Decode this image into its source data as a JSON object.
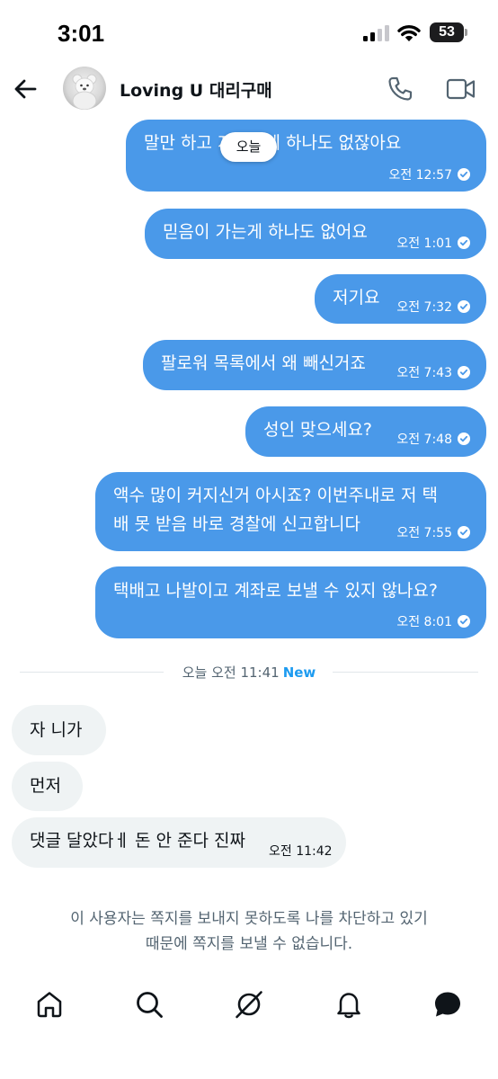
{
  "status_bar": {
    "time": "3:01",
    "battery": "53"
  },
  "header": {
    "title": "Loving U 대리구매",
    "icons": [
      "back-arrow-icon",
      "avatar",
      "phone-icon",
      "video-camera-icon"
    ]
  },
  "today_pill": "오늘",
  "sent_messages": [
    {
      "text": "말만 하고 지키신게 하나도 없잖아요",
      "time": "오전 12:57"
    },
    {
      "text": "믿음이 가는게 하나도 없어요",
      "time": "오전 1:01"
    },
    {
      "text": "저기요",
      "time": "오전 7:32"
    },
    {
      "text": "팔로워 목록에서 왜 빼신거죠",
      "time": "오전 7:43"
    },
    {
      "text": "성인 맞으세요?",
      "time": "오전 7:48"
    },
    {
      "text_line1": "액수 많이 커지신거 아시죠? 이번주내로 저 택",
      "text_line2": "배 못 받음 바로 경찰에 신고합니다",
      "time": "오전 7:55"
    },
    {
      "text": "택배고 나발이고 계좌로 보낼 수 있지 않나요?",
      "time": "오전 8:01"
    }
  ],
  "divider": {
    "label": "오늘 오전 11:41",
    "new_label": "New"
  },
  "received_messages": [
    {
      "text": "자 니가"
    },
    {
      "text": "먼저"
    },
    {
      "text": "댓글 달았다ㅔ 돈 안 준다 진짜",
      "time": "오전 11:42"
    }
  ],
  "blocked_notice": {
    "line1": "이 사용자는 쪽지를 보내지 못하도록 나를 차단하고 있기",
    "line2": "때문에 쪽지를 보낼 수 없습니다."
  },
  "bottom_nav": [
    "home-icon",
    "search-icon",
    "grok-icon",
    "notifications-icon",
    "messages-icon"
  ],
  "colors": {
    "sent_bubble": "#4a99e9",
    "received_bubble": "#eff3f4",
    "accent_new": "#1d9bf0",
    "muted_text": "#536471"
  }
}
